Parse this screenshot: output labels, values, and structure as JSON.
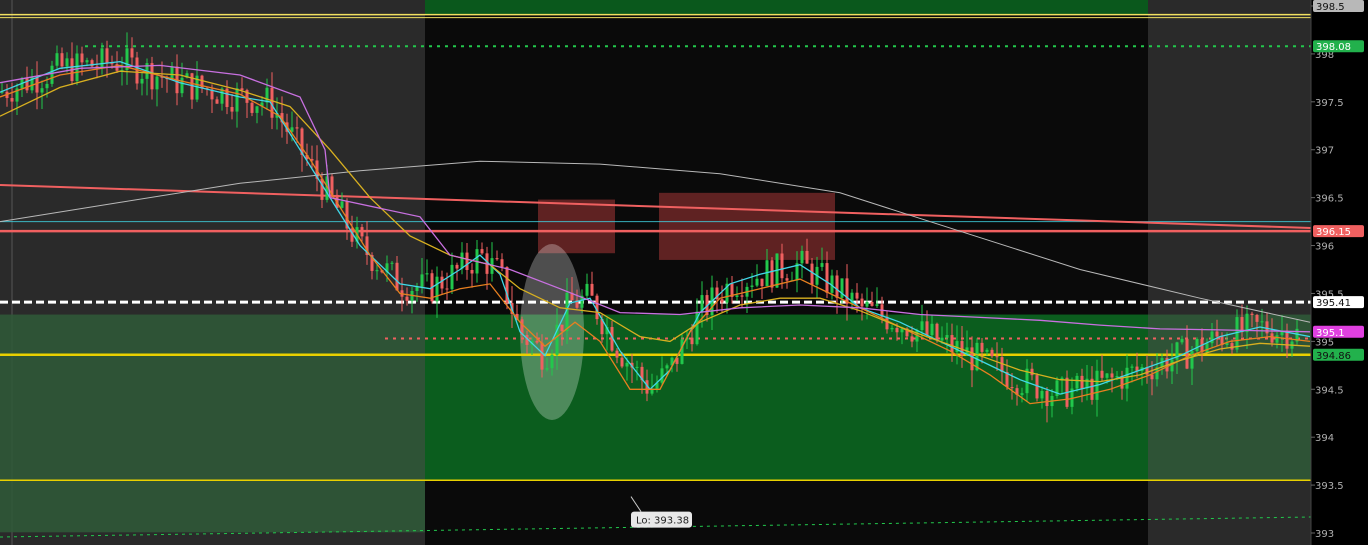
{
  "chart_data": {
    "type": "line",
    "title": "",
    "ylim": [
      392.95,
      398.6
    ],
    "y_ticks": [
      "398.5",
      "398",
      "397.5",
      "397",
      "396.5",
      "396",
      "395.5",
      "395",
      "394.5",
      "394",
      "393.5",
      "393"
    ],
    "y_tick_values": [
      398.5,
      398,
      397.5,
      397,
      396.5,
      396,
      395.5,
      395,
      394.5,
      394,
      393.5,
      393
    ],
    "price_tags": [
      {
        "label": "398.5",
        "value": 398.5,
        "bg": "#b8b8b8",
        "fg": "#111111"
      },
      {
        "label": "398.08",
        "value": 398.08,
        "bg": "#22b14c",
        "fg": "#ffffff"
      },
      {
        "label": "396.15",
        "value": 396.15,
        "bg": "#f06060",
        "fg": "#ffffff"
      },
      {
        "label": "395.41",
        "value": 395.41,
        "bg": "#ffffff",
        "fg": "#111111"
      },
      {
        "label": "395.1",
        "value": 395.1,
        "bg": "#e040e0",
        "fg": "#ffffff"
      },
      {
        "label": "394.86",
        "value": 394.86,
        "bg": "#22b14c",
        "fg": "#111111"
      }
    ],
    "horizontal_levels": [
      {
        "value": 398.41,
        "color": "#f0e060",
        "style": "solid"
      },
      {
        "value": 398.08,
        "color": "#22c84c",
        "style": "dotted"
      },
      {
        "value": 396.15,
        "color": "#f06060",
        "style": "solid"
      },
      {
        "value": 395.41,
        "color": "#ffffff",
        "style": "dashed"
      },
      {
        "value": 395.03,
        "color": "#f06060",
        "style": "dotted"
      },
      {
        "value": 394.86,
        "color": "#e8d000",
        "style": "solid"
      },
      {
        "value": 393.55,
        "color": "#e8d000",
        "style": "solid"
      }
    ],
    "low_annotation": {
      "label": "Lo: 393.38",
      "value": 393.38
    },
    "colors": {
      "up_candle": "#22c84c",
      "down_candle": "#f06060",
      "ema_fast": "#40d8e8",
      "ema_mid": "#e88020",
      "ema_slow": "#d8b020",
      "vwap": "#c870e0",
      "sma_long": "#b8b8b8",
      "trendline": "#f06060",
      "zone_green": "#0b5d1e",
      "zone_red": "#c84040"
    },
    "series": [
      {
        "key": "sma_long",
        "values": [
          [
            0,
            396.25
          ],
          [
            120,
            396.45
          ],
          [
            240,
            396.65
          ],
          [
            360,
            396.78
          ],
          [
            480,
            396.88
          ],
          [
            600,
            396.85
          ],
          [
            720,
            396.75
          ],
          [
            840,
            396.55
          ],
          [
            960,
            396.15
          ],
          [
            1080,
            395.75
          ],
          [
            1200,
            395.45
          ],
          [
            1310,
            395.2
          ]
        ]
      },
      {
        "key": "ema_fast",
        "values": [
          [
            0,
            397.6
          ],
          [
            60,
            397.85
          ],
          [
            120,
            397.92
          ],
          [
            180,
            397.7
          ],
          [
            240,
            397.55
          ],
          [
            270,
            397.5
          ],
          [
            300,
            397.0
          ],
          [
            330,
            396.5
          ],
          [
            360,
            396.0
          ],
          [
            400,
            395.6
          ],
          [
            430,
            395.55
          ],
          [
            460,
            395.75
          ],
          [
            480,
            395.9
          ],
          [
            500,
            395.7
          ],
          [
            520,
            395.1
          ],
          [
            545,
            394.85
          ],
          [
            570,
            395.4
          ],
          [
            590,
            395.45
          ],
          [
            620,
            394.9
          ],
          [
            650,
            394.5
          ],
          [
            670,
            394.7
          ],
          [
            700,
            395.3
          ],
          [
            730,
            395.6
          ],
          [
            760,
            395.7
          ],
          [
            800,
            395.8
          ],
          [
            830,
            395.6
          ],
          [
            860,
            395.35
          ],
          [
            900,
            395.2
          ],
          [
            940,
            395.0
          ],
          [
            980,
            394.8
          ],
          [
            1020,
            394.6
          ],
          [
            1060,
            394.45
          ],
          [
            1100,
            394.55
          ],
          [
            1140,
            394.7
          ],
          [
            1180,
            394.85
          ],
          [
            1220,
            395.05
          ],
          [
            1260,
            395.15
          ],
          [
            1310,
            395.05
          ]
        ]
      },
      {
        "key": "ema_mid",
        "values": [
          [
            0,
            397.55
          ],
          [
            60,
            397.78
          ],
          [
            120,
            397.88
          ],
          [
            180,
            397.72
          ],
          [
            240,
            397.58
          ],
          [
            280,
            397.35
          ],
          [
            310,
            396.9
          ],
          [
            340,
            396.4
          ],
          [
            370,
            395.9
          ],
          [
            400,
            395.5
          ],
          [
            430,
            395.45
          ],
          [
            460,
            395.55
          ],
          [
            490,
            395.6
          ],
          [
            520,
            395.2
          ],
          [
            545,
            394.95
          ],
          [
            575,
            395.2
          ],
          [
            600,
            395.0
          ],
          [
            630,
            394.5
          ],
          [
            660,
            394.5
          ],
          [
            690,
            395.1
          ],
          [
            720,
            395.45
          ],
          [
            760,
            395.55
          ],
          [
            800,
            395.65
          ],
          [
            830,
            395.5
          ],
          [
            870,
            395.3
          ],
          [
            910,
            395.1
          ],
          [
            950,
            394.9
          ],
          [
            990,
            394.65
          ],
          [
            1030,
            394.35
          ],
          [
            1070,
            394.4
          ],
          [
            1110,
            394.5
          ],
          [
            1150,
            394.65
          ],
          [
            1190,
            394.85
          ],
          [
            1230,
            395.0
          ],
          [
            1270,
            395.05
          ],
          [
            1310,
            395.0
          ]
        ]
      },
      {
        "key": "ema_slow",
        "values": [
          [
            0,
            397.35
          ],
          [
            60,
            397.65
          ],
          [
            120,
            397.82
          ],
          [
            180,
            397.78
          ],
          [
            240,
            397.62
          ],
          [
            290,
            397.45
          ],
          [
            330,
            397.0
          ],
          [
            370,
            396.5
          ],
          [
            410,
            396.1
          ],
          [
            450,
            395.9
          ],
          [
            490,
            395.8
          ],
          [
            520,
            395.55
          ],
          [
            560,
            395.35
          ],
          [
            600,
            395.3
          ],
          [
            640,
            395.05
          ],
          [
            670,
            395.0
          ],
          [
            700,
            395.2
          ],
          [
            740,
            395.38
          ],
          [
            780,
            395.45
          ],
          [
            820,
            395.45
          ],
          [
            860,
            395.32
          ],
          [
            900,
            395.15
          ],
          [
            940,
            395.0
          ],
          [
            980,
            394.85
          ],
          [
            1020,
            394.7
          ],
          [
            1060,
            394.6
          ],
          [
            1100,
            394.58
          ],
          [
            1140,
            394.65
          ],
          [
            1180,
            394.8
          ],
          [
            1220,
            394.92
          ],
          [
            1260,
            394.98
          ],
          [
            1310,
            394.95
          ]
        ]
      },
      {
        "key": "vwap",
        "values": [
          [
            0,
            397.7
          ],
          [
            80,
            397.85
          ],
          [
            160,
            397.88
          ],
          [
            240,
            397.78
          ],
          [
            300,
            397.55
          ],
          [
            325,
            397.0
          ],
          [
            330,
            396.5
          ],
          [
            420,
            396.3
          ],
          [
            450,
            395.9
          ],
          [
            510,
            395.75
          ],
          [
            560,
            395.55
          ],
          [
            620,
            395.3
          ],
          [
            680,
            395.28
          ],
          [
            740,
            395.35
          ],
          [
            800,
            395.38
          ],
          [
            860,
            395.35
          ],
          [
            920,
            395.28
          ],
          [
            980,
            395.25
          ],
          [
            1040,
            395.22
          ],
          [
            1100,
            395.17
          ],
          [
            1160,
            395.13
          ],
          [
            1220,
            395.12
          ],
          [
            1310,
            395.1
          ]
        ]
      }
    ]
  }
}
